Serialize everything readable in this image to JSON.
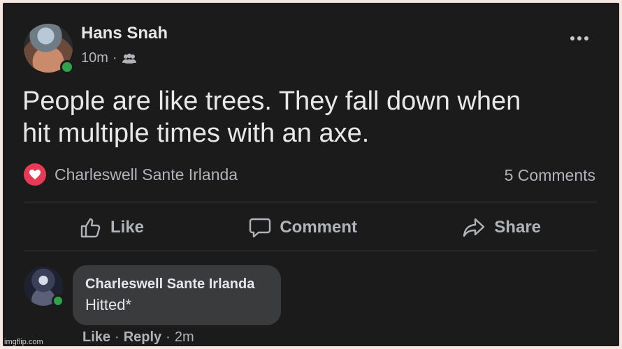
{
  "post": {
    "author": "Hans Snah",
    "time": "10m",
    "audience_icon": "friends-icon",
    "text_line1": "People are like trees. They fall down when",
    "text_line2": "hit multiple times with an axe.",
    "reaction_name": "Charleswell Sante Irlanda",
    "reaction_icon": "heart-icon",
    "comments_count": "5 Comments"
  },
  "actions": {
    "like": "Like",
    "comment": "Comment",
    "share": "Share"
  },
  "comment": {
    "author": "Charleswell Sante Irlanda",
    "text": "Hitted*",
    "like": "Like",
    "reply": "Reply",
    "time": "2m"
  },
  "colors": {
    "background": "#1b1b1c",
    "bubble": "#3a3b3c",
    "online": "#31a24c",
    "heart": "#e63a57"
  },
  "watermark": "imgflip.com"
}
